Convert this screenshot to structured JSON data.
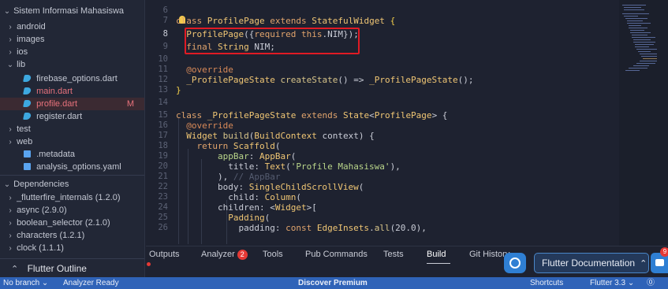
{
  "explorer": {
    "root": "Sistem Informasi Mahasiswa",
    "items": [
      {
        "label": "android",
        "chev": "›"
      },
      {
        "label": "images",
        "chev": "›"
      },
      {
        "label": "ios",
        "chev": "›"
      },
      {
        "label": "lib",
        "chev": "⌄"
      },
      {
        "label": "firebase_options.dart"
      },
      {
        "label": "main.dart"
      },
      {
        "label": "profile.dart",
        "status": "M"
      },
      {
        "label": "register.dart"
      },
      {
        "label": "test",
        "chev": "›"
      },
      {
        "label": "web",
        "chev": "›"
      },
      {
        "label": ".metadata"
      },
      {
        "label": "analysis_options.yaml"
      }
    ]
  },
  "dependencies": {
    "title": "Dependencies",
    "items": [
      "_flutterfire_internals (1.2.0)",
      "async (2.9.0)",
      "boolean_selector (2.1.0)",
      "characters (1.2.1)",
      "clock (1.1.1)"
    ]
  },
  "outline": {
    "label": "Flutter Outline",
    "icon": "double-chevron-up-icon"
  },
  "editor": {
    "line_numbers": [
      "6",
      "7",
      "8",
      "9",
      "10",
      "11",
      "12",
      "13",
      "14",
      "15",
      "16",
      "17",
      "18",
      "19",
      "20",
      "21",
      "22",
      "23",
      "24",
      "25",
      "26"
    ],
    "current_line": "8"
  },
  "panel": {
    "tabs": [
      "Outputs",
      "Analyzer",
      "Tools",
      "Pub Commands",
      "Tests",
      "Build",
      "Git History"
    ],
    "analyzer_count": "2",
    "active_tab": "Build",
    "flutter_docs_label": "Flutter Documentation",
    "message_count": "9"
  },
  "status": {
    "branch": "No branch",
    "analyzer": "Analyzer Ready",
    "promo": "Discover Premium",
    "shortcuts": "Shortcuts",
    "flutter_version": "Flutter 3.3"
  },
  "colors": {
    "accent": "#2f63b8",
    "highlight_border": "#e01b24",
    "badge_red": "#e53935",
    "modified_red": "#e8727c"
  }
}
